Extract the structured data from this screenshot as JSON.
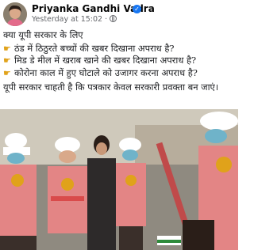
{
  "post": {
    "author": "Priyanka Gandhi Vadra",
    "timestamp": "Yesterday at 15:02",
    "intro": "क्या यूपी सरकार के लिए",
    "points": [
      "ठंड में ठिठुरते बच्चों की खबर दिखाना अपराध है?",
      "मिड डे मील में खराब खाने की खबर दिखाना अपराध है?",
      "कोरोना काल में हुए घोटाले को उजागर करना अपराध है?"
    ],
    "closing": "यूपी सरकार चाहती है कि पत्रकार केवल सरकारी प्रवक्ता बन जाएं।"
  },
  "icons": {
    "verified": "verified-badge-icon",
    "privacy": "globe-icon",
    "bullet": "backhand-pointing-right-icon"
  },
  "colors": {
    "name": "#050505",
    "meta": "#65676b",
    "verified": "#1877f2",
    "bullet": "#e0a21a"
  }
}
